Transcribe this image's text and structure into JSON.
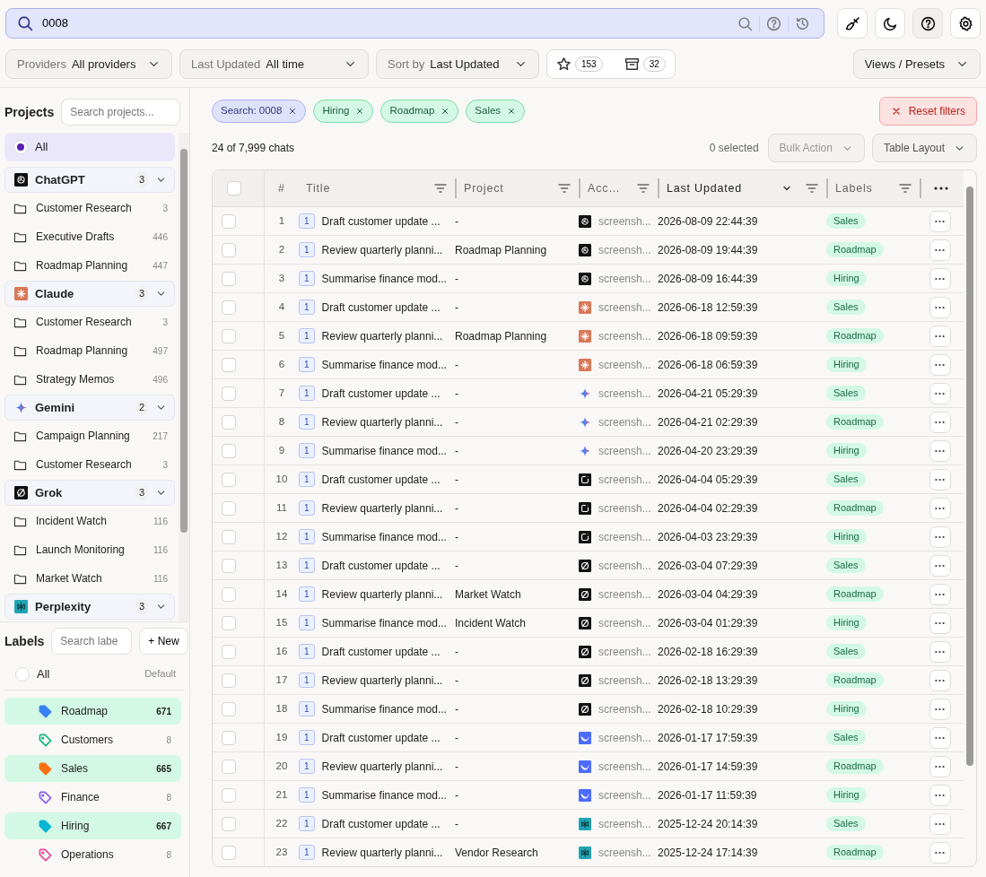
{
  "search": {
    "value": "0008"
  },
  "filters": [
    {
      "label": "Providers",
      "value": "All providers"
    },
    {
      "label": "Last Updated",
      "value": "All time"
    },
    {
      "label": "Sort by",
      "value": "Last Updated"
    }
  ],
  "counters": [
    {
      "kind": "starred",
      "count": "153"
    },
    {
      "kind": "archived",
      "count": "32"
    }
  ],
  "views_button": "Views / Presets",
  "projects": {
    "title": "Projects",
    "search_placeholder": "Search projects...",
    "all": {
      "label": "All",
      "selected": true
    },
    "groups": [
      {
        "name": "ChatGPT",
        "kind": "chatgpt",
        "count": "3",
        "expanded": true,
        "children": [
          {
            "name": "Customer Research",
            "count": "3"
          },
          {
            "name": "Executive Drafts",
            "count": "446"
          },
          {
            "name": "Roadmap Planning",
            "count": "447"
          }
        ]
      },
      {
        "name": "Claude",
        "kind": "claude",
        "count": "3",
        "expanded": true,
        "children": [
          {
            "name": "Customer Research",
            "count": "3"
          },
          {
            "name": "Roadmap Planning",
            "count": "497"
          },
          {
            "name": "Strategy Memos",
            "count": "496"
          }
        ]
      },
      {
        "name": "Gemini",
        "kind": "gemini",
        "count": "2",
        "expanded": true,
        "children": [
          {
            "name": "Campaign Planning",
            "count": "217"
          },
          {
            "name": "Customer Research",
            "count": "3"
          }
        ]
      },
      {
        "name": "Grok",
        "kind": "grok",
        "count": "3",
        "expanded": true,
        "children": [
          {
            "name": "Incident Watch",
            "count": "116"
          },
          {
            "name": "Launch Monitoring",
            "count": "116"
          },
          {
            "name": "Market Watch",
            "count": "116"
          }
        ]
      },
      {
        "name": "Perplexity",
        "kind": "perplexity",
        "count": "3",
        "expanded": true
      }
    ]
  },
  "labels": {
    "title": "Labels",
    "search_placeholder": "Search labe",
    "new_button": "+ New",
    "all": {
      "label": "All",
      "note": "Default",
      "selected": false
    },
    "items": [
      {
        "name": "Roadmap",
        "count": "671",
        "color": "#3b82f6",
        "selected": true
      },
      {
        "name": "Customers",
        "count": "8",
        "color": "#10b981",
        "selected": false
      },
      {
        "name": "Sales",
        "count": "665",
        "color": "#f97316",
        "selected": true
      },
      {
        "name": "Finance",
        "count": "8",
        "color": "#8b5cf6",
        "selected": false
      },
      {
        "name": "Hiring",
        "count": "667",
        "color": "#06b6d4",
        "selected": true
      },
      {
        "name": "Operations",
        "count": "8",
        "color": "#ec4899",
        "selected": false
      }
    ]
  },
  "chips": [
    {
      "text": "Search: 0008",
      "kind": "search"
    },
    {
      "text": "Hiring",
      "kind": "label"
    },
    {
      "text": "Roadmap",
      "kind": "label"
    },
    {
      "text": "Sales",
      "kind": "label"
    }
  ],
  "reset_button": "Reset filters",
  "summary": "24 of 7,999 chats",
  "selected_count": "0 selected",
  "bulk_button": "Bulk Action",
  "layout_button": "Table Layout",
  "table": {
    "select_all": {
      "checked": false
    },
    "columns": [
      {
        "label": "#",
        "filter": false,
        "sorted": false
      },
      {
        "label": "Title",
        "filter": true,
        "sorted": false
      },
      {
        "label": "Project",
        "filter": true,
        "sorted": false
      },
      {
        "label": "Acc…",
        "filter": true,
        "sorted": false
      },
      {
        "label": "Last Updated",
        "filter": true,
        "sorted": true
      },
      {
        "label": "Labels",
        "filter": true,
        "sorted": false
      }
    ],
    "rows": [
      {
        "num": "1",
        "messages": "1",
        "title": "Draft customer update ...",
        "project": "-",
        "kind": "chatgpt",
        "account": "screensh...",
        "updated": "2026-08-09 22:44:39",
        "label": "Sales",
        "checked": false
      },
      {
        "num": "2",
        "messages": "1",
        "title": "Review quarterly planni...",
        "project": "Roadmap Planning",
        "kind": "chatgpt",
        "account": "screensh...",
        "updated": "2026-08-09 19:44:39",
        "label": "Roadmap",
        "checked": false
      },
      {
        "num": "3",
        "messages": "1",
        "title": "Summarise finance mod...",
        "project": "-",
        "kind": "chatgpt",
        "account": "screensh...",
        "updated": "2026-08-09 16:44:39",
        "label": "Hiring",
        "checked": false
      },
      {
        "num": "4",
        "messages": "1",
        "title": "Draft customer update ...",
        "project": "-",
        "kind": "claude",
        "account": "screensh...",
        "updated": "2026-06-18 12:59:39",
        "label": "Sales",
        "checked": false
      },
      {
        "num": "5",
        "messages": "1",
        "title": "Review quarterly planni...",
        "project": "Roadmap Planning",
        "kind": "claude",
        "account": "screensh...",
        "updated": "2026-06-18 09:59:39",
        "label": "Roadmap",
        "checked": false
      },
      {
        "num": "6",
        "messages": "1",
        "title": "Summarise finance mod...",
        "project": "-",
        "kind": "claude",
        "account": "screensh...",
        "updated": "2026-06-18 06:59:39",
        "label": "Hiring",
        "checked": false
      },
      {
        "num": "7",
        "messages": "1",
        "title": "Draft customer update ...",
        "project": "-",
        "kind": "gemini",
        "account": "screensh...",
        "updated": "2026-04-21 05:29:39",
        "label": "Sales",
        "checked": false
      },
      {
        "num": "8",
        "messages": "1",
        "title": "Review quarterly planni...",
        "project": "-",
        "kind": "gemini",
        "account": "screensh...",
        "updated": "2026-04-21 02:29:39",
        "label": "Roadmap",
        "checked": false
      },
      {
        "num": "9",
        "messages": "1",
        "title": "Summarise finance mod...",
        "project": "-",
        "kind": "gemini",
        "account": "screensh...",
        "updated": "2026-04-20 23:29:39",
        "label": "Hiring",
        "checked": false
      },
      {
        "num": "10",
        "messages": "1",
        "title": "Draft customer update ...",
        "project": "-",
        "kind": "copilot",
        "account": "screensh...",
        "updated": "2026-04-04 05:29:39",
        "label": "Sales",
        "checked": false
      },
      {
        "num": "11",
        "messages": "1",
        "title": "Review quarterly planni...",
        "project": "-",
        "kind": "copilot",
        "account": "screensh...",
        "updated": "2026-04-04 02:29:39",
        "label": "Roadmap",
        "checked": false
      },
      {
        "num": "12",
        "messages": "1",
        "title": "Summarise finance mod...",
        "project": "-",
        "kind": "copilot",
        "account": "screensh...",
        "updated": "2026-04-03 23:29:39",
        "label": "Hiring",
        "checked": false
      },
      {
        "num": "13",
        "messages": "1",
        "title": "Draft customer update ...",
        "project": "-",
        "kind": "grok",
        "account": "screensh...",
        "updated": "2026-03-04 07:29:39",
        "label": "Sales",
        "checked": false
      },
      {
        "num": "14",
        "messages": "1",
        "title": "Review quarterly planni...",
        "project": "Market Watch",
        "kind": "grok",
        "account": "screensh...",
        "updated": "2026-03-04 04:29:39",
        "label": "Roadmap",
        "checked": false
      },
      {
        "num": "15",
        "messages": "1",
        "title": "Summarise finance mod...",
        "project": "Incident Watch",
        "kind": "grok",
        "account": "screensh...",
        "updated": "2026-03-04 01:29:39",
        "label": "Hiring",
        "checked": false
      },
      {
        "num": "16",
        "messages": "1",
        "title": "Draft customer update ...",
        "project": "-",
        "kind": "grok",
        "account": "screensh...",
        "updated": "2026-02-18 16:29:39",
        "label": "Sales",
        "checked": false
      },
      {
        "num": "17",
        "messages": "1",
        "title": "Review quarterly planni...",
        "project": "-",
        "kind": "grok",
        "account": "screensh...",
        "updated": "2026-02-18 13:29:39",
        "label": "Roadmap",
        "checked": false
      },
      {
        "num": "18",
        "messages": "1",
        "title": "Summarise finance mod...",
        "project": "-",
        "kind": "grok",
        "account": "screensh...",
        "updated": "2026-02-18 10:29:39",
        "label": "Hiring",
        "checked": false
      },
      {
        "num": "19",
        "messages": "1",
        "title": "Draft customer update ...",
        "project": "-",
        "kind": "deepseek",
        "account": "screensh...",
        "updated": "2026-01-17 17:59:39",
        "label": "Sales",
        "checked": false
      },
      {
        "num": "20",
        "messages": "1",
        "title": "Review quarterly planni...",
        "project": "-",
        "kind": "deepseek",
        "account": "screensh...",
        "updated": "2026-01-17 14:59:39",
        "label": "Roadmap",
        "checked": false
      },
      {
        "num": "21",
        "messages": "1",
        "title": "Summarise finance mod...",
        "project": "-",
        "kind": "deepseek",
        "account": "screensh...",
        "updated": "2026-01-17 11:59:39",
        "label": "Hiring",
        "checked": false
      },
      {
        "num": "22",
        "messages": "1",
        "title": "Draft customer update ...",
        "project": "-",
        "kind": "perplexity",
        "account": "screensh...",
        "updated": "2025-12-24 20:14:39",
        "label": "Sales",
        "checked": false
      },
      {
        "num": "23",
        "messages": "1",
        "title": "Review quarterly planni...",
        "project": "Vendor Research",
        "kind": "perplexity",
        "account": "screensh...",
        "updated": "2025-12-24 17:14:39",
        "label": "Roadmap",
        "checked": false
      }
    ]
  }
}
